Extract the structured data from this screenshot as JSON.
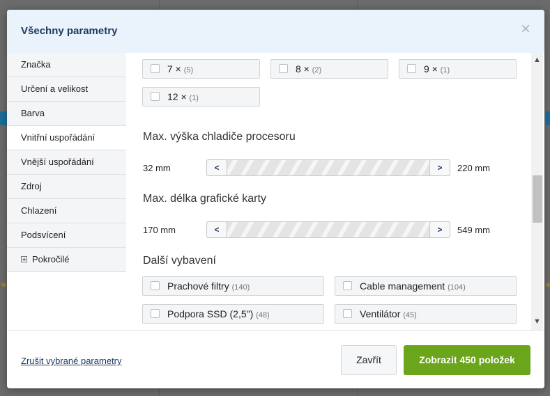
{
  "modal": {
    "title": "Všechny parametry",
    "close_glyph": "×"
  },
  "sidebar": {
    "items": [
      {
        "label": "Značka"
      },
      {
        "label": "Určení a velikost"
      },
      {
        "label": "Barva"
      },
      {
        "label": "Vnitřní uspořádání",
        "active": true
      },
      {
        "label": "Vnější uspořádání"
      },
      {
        "label": "Zdroj"
      },
      {
        "label": "Chlazení"
      },
      {
        "label": "Podsvícení"
      },
      {
        "label": "Pokročilé",
        "expandable": true
      }
    ]
  },
  "fan_options": [
    {
      "label": "7 ×",
      "count": "(5)"
    },
    {
      "label": "8 ×",
      "count": "(2)"
    },
    {
      "label": "9 ×",
      "count": "(1)"
    },
    {
      "label": "12 ×",
      "count": "(1)"
    }
  ],
  "cooler_height": {
    "title": "Max. výška chladiče procesoru",
    "min": "32 mm",
    "max": "220 mm"
  },
  "gpu_length": {
    "title": "Max. délka grafické karty",
    "min": "170 mm",
    "max": "549 mm"
  },
  "slider": {
    "left_glyph": "<",
    "right_glyph": ">"
  },
  "extras": {
    "title": "Další vybavení",
    "options": [
      {
        "label": "Prachové filtry",
        "count": "(140)"
      },
      {
        "label": "Cable management",
        "count": "(104)"
      },
      {
        "label": "Podpora SSD (2,5\")",
        "count": "(48)"
      },
      {
        "label": "Ventilátor",
        "count": "(45)"
      }
    ]
  },
  "scrollbar": {
    "up_glyph": "▲",
    "down_glyph": "▼"
  },
  "footer": {
    "reset_label": "Zrušit vybrané parametry",
    "close_label": "Zavřít",
    "show_label": "Zobrazit 450 položek"
  },
  "colors": {
    "accent_green": "#6aa51b",
    "title_blue": "#1d3a5f",
    "header_bg": "#eaf3fb"
  }
}
